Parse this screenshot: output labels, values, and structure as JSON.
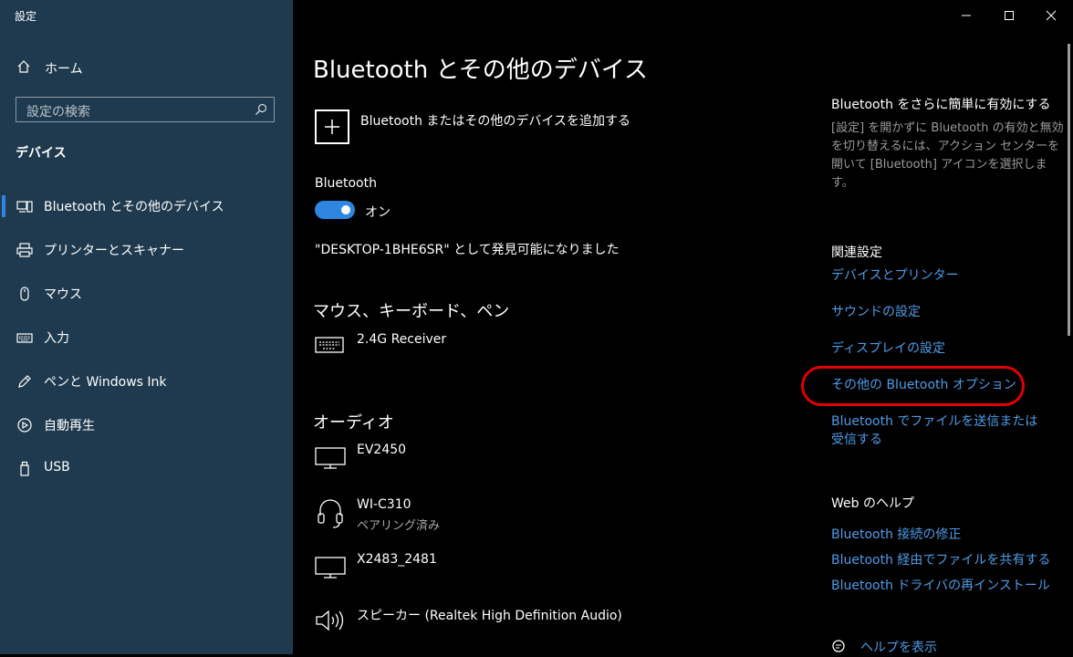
{
  "window": {
    "title": "設定"
  },
  "sidebar": {
    "home_label": "ホーム",
    "search_placeholder": "設定の検索",
    "section_title": "デバイス",
    "items": [
      {
        "label": "Bluetooth とその他のデバイス",
        "icon": "bluetooth-devices-icon",
        "selected": true
      },
      {
        "label": "プリンターとスキャナー",
        "icon": "printer-icon"
      },
      {
        "label": "マウス",
        "icon": "mouse-icon"
      },
      {
        "label": "入力",
        "icon": "keyboard-icon"
      },
      {
        "label": "ペンと Windows Ink",
        "icon": "pen-icon"
      },
      {
        "label": "自動再生",
        "icon": "autoplay-icon"
      },
      {
        "label": "USB",
        "icon": "usb-icon"
      }
    ]
  },
  "main": {
    "title": "Bluetooth とその他のデバイス",
    "add_device_label": "Bluetooth またはその他のデバイスを追加する",
    "bluetooth_label": "Bluetooth",
    "toggle_state": "オン",
    "discoverable_text": "\"DESKTOP-1BHE6SR\" として発見可能になりました",
    "groups": {
      "input_title": "マウス、キーボード、ペン",
      "input_devices": [
        {
          "name": "2.4G Receiver",
          "icon": "keyboard-icon"
        }
      ],
      "audio_title": "オーディオ",
      "audio_devices": [
        {
          "name": "EV2450",
          "icon": "monitor-icon"
        },
        {
          "name": "WI-C310",
          "status": "ペアリング済み",
          "icon": "headset-icon"
        },
        {
          "name": "X2483_2481",
          "icon": "monitor-icon"
        },
        {
          "name": "スピーカー (Realtek High Definition Audio)",
          "icon": "speaker-icon"
        }
      ]
    }
  },
  "right": {
    "tip_title": "Bluetooth をさらに簡単に有効にする",
    "tip_text": "[設定] を開かずに Bluetooth の有効と無効を切り替えるには、アクション センターを開いて [Bluetooth] アイコンを選択します。",
    "related_title": "関連設定",
    "related_links": [
      "デバイスとプリンター",
      "サウンドの設定",
      "ディスプレイの設定",
      "その他の Bluetooth オプション",
      "Bluetooth でファイルを送信または受信する"
    ],
    "web_help_title": "Web のヘルプ",
    "help_links": [
      "Bluetooth 接続の修正",
      "Bluetooth 経由でファイルを共有する",
      "Bluetooth ドライバの再インストール"
    ],
    "get_help": "ヘルプを表示"
  },
  "colors": {
    "accent": "#2f86e0",
    "link": "#4c9ce8",
    "sidebar_bg": "#1f3a4e",
    "highlight": "#e00000"
  }
}
